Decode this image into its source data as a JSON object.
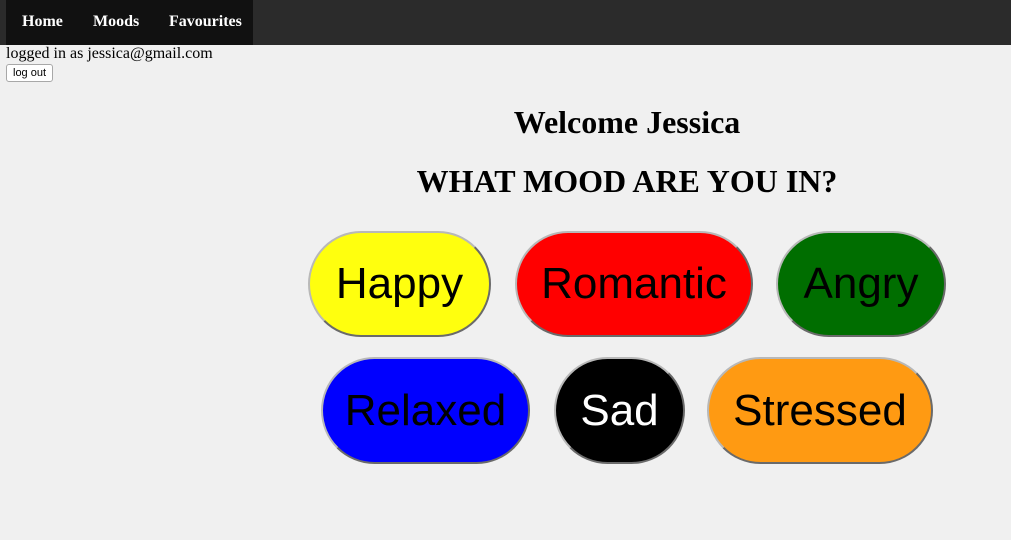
{
  "nav": {
    "items": [
      {
        "label": "Home"
      },
      {
        "label": "Moods"
      },
      {
        "label": "Favourites"
      }
    ]
  },
  "session": {
    "logged_in_text": "logged in as jessica@gmail.com",
    "logout_label": "log out"
  },
  "main": {
    "welcome": "Welcome Jessica",
    "question": "WHAT MOOD ARE YOU IN?"
  },
  "moods": [
    {
      "label": "Happy",
      "bg": "#ffff0e",
      "fg": "#000000"
    },
    {
      "label": "Romantic",
      "bg": "#ff0000",
      "fg": "#000000"
    },
    {
      "label": "Angry",
      "bg": "#006e00",
      "fg": "#000000"
    },
    {
      "label": "Relaxed",
      "bg": "#0000ff",
      "fg": "#000000"
    },
    {
      "label": "Sad",
      "bg": "#000000",
      "fg": "#ffffff"
    },
    {
      "label": "Stressed",
      "bg": "#ff9a12",
      "fg": "#000000"
    }
  ]
}
